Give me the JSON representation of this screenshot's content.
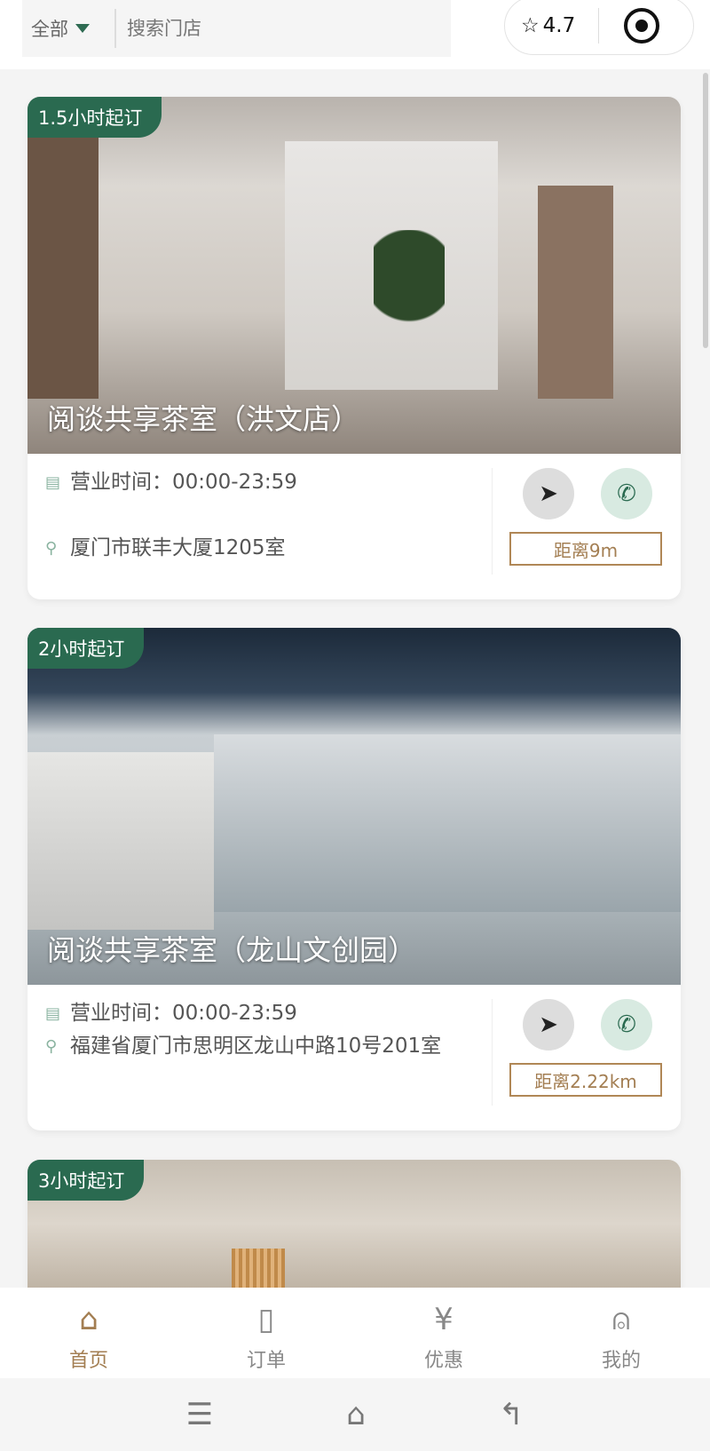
{
  "header": {
    "filter_label": "全部",
    "search_placeholder": "搜索门店",
    "rating": "4.7"
  },
  "stores": [
    {
      "tag": "1.5小时起订",
      "name": "阅谈共享茶室（洪文店）",
      "hours": "营业时间：00:00-23:59",
      "address": "厦门市联丰大厦1205室",
      "distance": "距离9m"
    },
    {
      "tag": "2小时起订",
      "name": "阅谈共享茶室（龙山文创园）",
      "hours": "营业时间：00:00-23:59",
      "address": "福建省厦门市思明区龙山中路10号201室",
      "distance": "距离2.22km"
    },
    {
      "tag": "3小时起订"
    }
  ],
  "tabs": [
    {
      "label": "首页",
      "icon": "home-icon"
    },
    {
      "label": "订单",
      "icon": "order-icon"
    },
    {
      "label": "优惠",
      "icon": "coupon-icon"
    },
    {
      "label": "我的",
      "icon": "user-icon"
    }
  ],
  "colors": {
    "brand_green": "#2a6a50",
    "accent_brown": "#a37e52"
  }
}
